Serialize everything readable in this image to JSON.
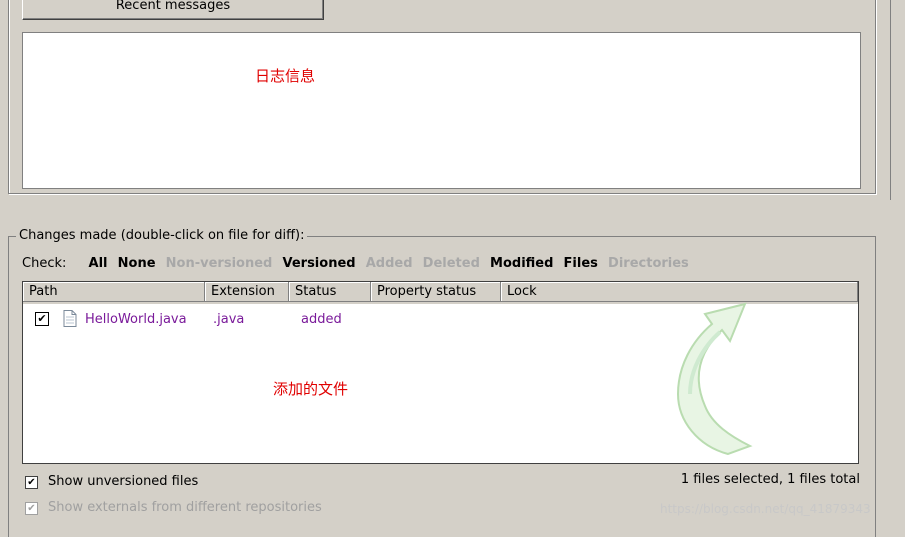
{
  "top": {
    "recent_button": "Recent messages",
    "log_note": "日志信息"
  },
  "changes": {
    "group_label": "Changes made (double-click on file for diff):",
    "check_label": "Check:",
    "filters": [
      {
        "label": "All",
        "enabled": true
      },
      {
        "label": "None",
        "enabled": true
      },
      {
        "label": "Non-versioned",
        "enabled": false
      },
      {
        "label": "Versioned",
        "enabled": true
      },
      {
        "label": "Added",
        "enabled": false
      },
      {
        "label": "Deleted",
        "enabled": false
      },
      {
        "label": "Modified",
        "enabled": true
      },
      {
        "label": "Files",
        "enabled": true
      },
      {
        "label": "Directories",
        "enabled": false
      }
    ],
    "columns": [
      "Path",
      "Extension",
      "Status",
      "Property status",
      "Lock"
    ],
    "rows": [
      {
        "checked": true,
        "path": "HelloWorld.java",
        "extension": ".java",
        "status": "added"
      }
    ],
    "added_note": "添加的文件"
  },
  "options": {
    "show_unversioned": "Show unversioned files",
    "show_externals": "Show externals from different repositories",
    "summary": "1 files selected, 1 files total"
  },
  "watermark": "https://blog.csdn.net/qq_41879343"
}
